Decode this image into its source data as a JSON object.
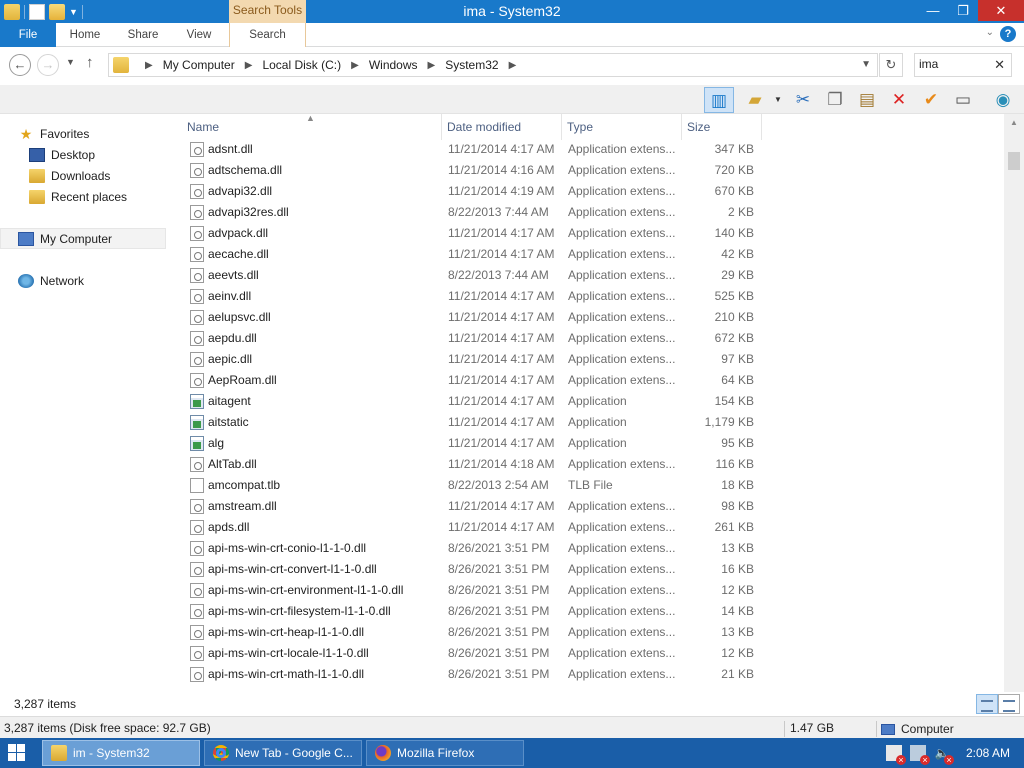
{
  "window": {
    "title": "ima - System32",
    "context_tab": "Search Tools",
    "controls": {
      "minimize": "—",
      "maximize": "❐",
      "close": "✕"
    }
  },
  "ribbon": {
    "tabs": {
      "file": "File",
      "home": "Home",
      "share": "Share",
      "view": "View",
      "search": "Search"
    },
    "help": "?"
  },
  "address": {
    "crumbs": [
      "My Computer",
      "Local Disk (C:)",
      "Windows",
      "System32"
    ]
  },
  "search": {
    "value": "ima"
  },
  "nav": {
    "favorites": "Favorites",
    "desktop": "Desktop",
    "downloads": "Downloads",
    "recent": "Recent places",
    "computer": "My Computer",
    "network": "Network"
  },
  "columns": {
    "name": "Name",
    "date": "Date modified",
    "type": "Type",
    "size": "Size"
  },
  "files": [
    {
      "name": "adsnt.dll",
      "date": "11/21/2014 4:17 AM",
      "type": "Application extens...",
      "size": "347 KB",
      "icon": "dll"
    },
    {
      "name": "adtschema.dll",
      "date": "11/21/2014 4:16 AM",
      "type": "Application extens...",
      "size": "720 KB",
      "icon": "dll"
    },
    {
      "name": "advapi32.dll",
      "date": "11/21/2014 4:19 AM",
      "type": "Application extens...",
      "size": "670 KB",
      "icon": "dll"
    },
    {
      "name": "advapi32res.dll",
      "date": "8/22/2013 7:44 AM",
      "type": "Application extens...",
      "size": "2 KB",
      "icon": "dll"
    },
    {
      "name": "advpack.dll",
      "date": "11/21/2014 4:17 AM",
      "type": "Application extens...",
      "size": "140 KB",
      "icon": "dll"
    },
    {
      "name": "aecache.dll",
      "date": "11/21/2014 4:17 AM",
      "type": "Application extens...",
      "size": "42 KB",
      "icon": "dll"
    },
    {
      "name": "aeevts.dll",
      "date": "8/22/2013 7:44 AM",
      "type": "Application extens...",
      "size": "29 KB",
      "icon": "dll"
    },
    {
      "name": "aeinv.dll",
      "date": "11/21/2014 4:17 AM",
      "type": "Application extens...",
      "size": "525 KB",
      "icon": "dll"
    },
    {
      "name": "aelupsvc.dll",
      "date": "11/21/2014 4:17 AM",
      "type": "Application extens...",
      "size": "210 KB",
      "icon": "dll"
    },
    {
      "name": "aepdu.dll",
      "date": "11/21/2014 4:17 AM",
      "type": "Application extens...",
      "size": "672 KB",
      "icon": "dll"
    },
    {
      "name": "aepic.dll",
      "date": "11/21/2014 4:17 AM",
      "type": "Application extens...",
      "size": "97 KB",
      "icon": "dll"
    },
    {
      "name": "AepRoam.dll",
      "date": "11/21/2014 4:17 AM",
      "type": "Application extens...",
      "size": "64 KB",
      "icon": "dll"
    },
    {
      "name": "aitagent",
      "date": "11/21/2014 4:17 AM",
      "type": "Application",
      "size": "154 KB",
      "icon": "exe"
    },
    {
      "name": "aitstatic",
      "date": "11/21/2014 4:17 AM",
      "type": "Application",
      "size": "1,179 KB",
      "icon": "exe"
    },
    {
      "name": "alg",
      "date": "11/21/2014 4:17 AM",
      "type": "Application",
      "size": "95 KB",
      "icon": "exe"
    },
    {
      "name": "AltTab.dll",
      "date": "11/21/2014 4:18 AM",
      "type": "Application extens...",
      "size": "116 KB",
      "icon": "dll"
    },
    {
      "name": "amcompat.tlb",
      "date": "8/22/2013 2:54 AM",
      "type": "TLB File",
      "size": "18 KB",
      "icon": "file"
    },
    {
      "name": "amstream.dll",
      "date": "11/21/2014 4:17 AM",
      "type": "Application extens...",
      "size": "98 KB",
      "icon": "dll"
    },
    {
      "name": "apds.dll",
      "date": "11/21/2014 4:17 AM",
      "type": "Application extens...",
      "size": "261 KB",
      "icon": "dll"
    },
    {
      "name": "api-ms-win-crt-conio-l1-1-0.dll",
      "date": "8/26/2021 3:51 PM",
      "type": "Application extens...",
      "size": "13 KB",
      "icon": "dll"
    },
    {
      "name": "api-ms-win-crt-convert-l1-1-0.dll",
      "date": "8/26/2021 3:51 PM",
      "type": "Application extens...",
      "size": "16 KB",
      "icon": "dll"
    },
    {
      "name": "api-ms-win-crt-environment-l1-1-0.dll",
      "date": "8/26/2021 3:51 PM",
      "type": "Application extens...",
      "size": "12 KB",
      "icon": "dll"
    },
    {
      "name": "api-ms-win-crt-filesystem-l1-1-0.dll",
      "date": "8/26/2021 3:51 PM",
      "type": "Application extens...",
      "size": "14 KB",
      "icon": "dll"
    },
    {
      "name": "api-ms-win-crt-heap-l1-1-0.dll",
      "date": "8/26/2021 3:51 PM",
      "type": "Application extens...",
      "size": "13 KB",
      "icon": "dll"
    },
    {
      "name": "api-ms-win-crt-locale-l1-1-0.dll",
      "date": "8/26/2021 3:51 PM",
      "type": "Application extens...",
      "size": "12 KB",
      "icon": "dll"
    },
    {
      "name": "api-ms-win-crt-math-l1-1-0.dll",
      "date": "8/26/2021 3:51 PM",
      "type": "Application extens...",
      "size": "21 KB",
      "icon": "dll"
    }
  ],
  "status": {
    "count": "3,287 items",
    "free_space": "3,287 items (Disk free space: 92.7 GB)",
    "size": "1.47 GB",
    "location": "Computer"
  },
  "taskbar": {
    "tasks": [
      "im - System32",
      "New Tab - Google C...",
      "Mozilla Firefox"
    ],
    "clock": "2:08 AM"
  }
}
